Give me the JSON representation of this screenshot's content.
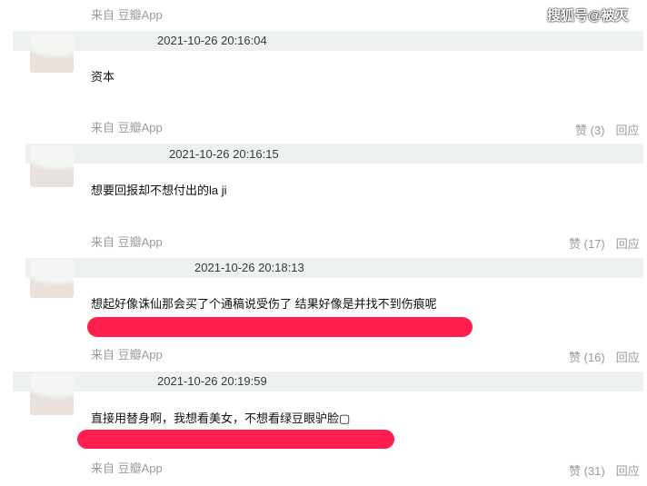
{
  "watermark": "搜狐号@被灭",
  "comments": [
    {
      "source_top": "来自 豆瓣App",
      "time": "2021-10-26 20:16:04",
      "text": "资本",
      "source_bottom": "来自 豆瓣App",
      "likes": "赞 (3)",
      "reply": "回应",
      "redacted": false
    },
    {
      "time": "2021-10-26 20:16:15",
      "text": "想要回报却不想付出的la ji",
      "source_bottom": "来自 豆瓣App",
      "likes": "赞 (17)",
      "reply": "回应",
      "redacted": false
    },
    {
      "time": "2021-10-26 20:18:13",
      "text": "想起好像诛仙那会买了个通稿说受伤了 结果好像是并找不到伤痕呢",
      "source_bottom": "来自 豆瓣App",
      "likes": "赞 (16)",
      "reply": "回应",
      "redacted": true
    },
    {
      "time": "2021-10-26 20:19:59",
      "text": "直接用替身啊，我想看美女，不想看绿豆眼驴脸▢",
      "source_bottom": "来自 豆瓣App",
      "likes": "赞 (31)",
      "reply": "回应",
      "redacted": true
    }
  ],
  "colors": {
    "meta_bar": "#eef2ee",
    "redaction": "#ff1f4e",
    "muted_text": "#9a9a9a"
  }
}
